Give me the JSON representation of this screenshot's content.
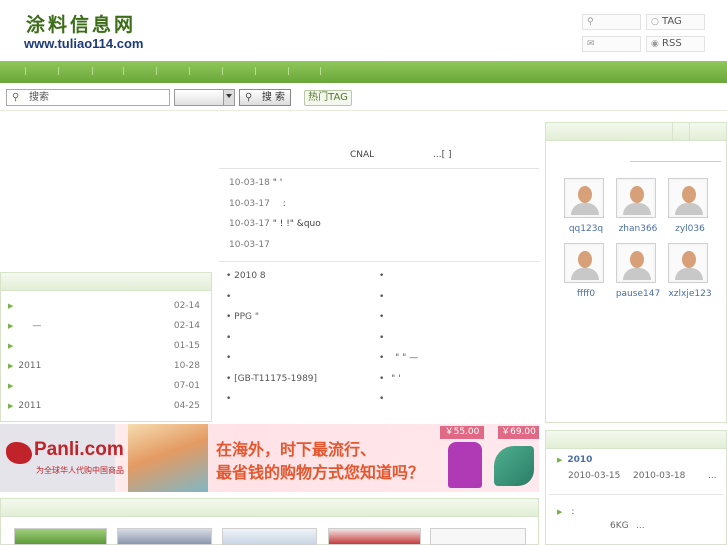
{
  "header": {
    "logo_cn": "涂料信息网",
    "logo_url": "www.tuliao114.com",
    "top_links": [
      {
        "icon": "user-icon",
        "label": ""
      },
      {
        "icon": "search-icon",
        "label": "TAG"
      },
      {
        "icon": "mail-icon",
        "label": ""
      },
      {
        "icon": "rss-icon",
        "label": "RSS"
      }
    ]
  },
  "search": {
    "placeholder": "搜索",
    "value": "搜索",
    "button_label": "搜 索",
    "hot_tag_label": "热门TAG"
  },
  "main": {
    "headline": "CNAL",
    "headline_more": "...[   ]",
    "news": [
      {
        "date": "10-03-18",
        "text": "\"   '"
      },
      {
        "date": "10-03-17",
        "text": ":"
      },
      {
        "date": "10-03-17",
        "text": "\" ! !\" &quo"
      },
      {
        "date": "10-03-17",
        "text": ""
      }
    ],
    "bullets_left": [
      "2010 8",
      "",
      "PPG      \"",
      "",
      "",
      "[GB-T11175-1989]",
      ""
    ],
    "bullets_right": [
      "",
      "",
      "",
      "",
      "\" \" —",
      "\"  '",
      ""
    ]
  },
  "left_list": [
    {
      "text": "",
      "date": "02-14"
    },
    {
      "text": "—",
      "date": "02-14"
    },
    {
      "text": "",
      "date": "01-15"
    },
    {
      "text": "2011",
      "date": "10-28"
    },
    {
      "text": "",
      "date": "07-01"
    },
    {
      "text": "2011",
      "date": "04-25"
    }
  ],
  "members": [
    {
      "name": "qq123q"
    },
    {
      "name": "zhan366"
    },
    {
      "name": "zyl036"
    },
    {
      "name": "ffff0"
    },
    {
      "name": "pause147"
    },
    {
      "name": "xzlxje123"
    }
  ],
  "right_bottom": {
    "item1_title": "2010",
    "item1_date1": "2010-03-15",
    "item1_date2": "2010-03-18",
    "item1_more": "...",
    "item2_title": ":",
    "item2_text": "6KG",
    "item2_more": "..."
  },
  "banner": {
    "brand": "Panli.com",
    "brand_sub": "为全球华人代购中国商品",
    "slogan_line1": "在海外，时下最流行、",
    "slogan_line2": "最省钱的购物方式您知道吗？",
    "price1": "￥55.00",
    "price2": "￥69.00"
  },
  "colors": {
    "nav_green": "#6aa63a",
    "logo_green": "#3c6e1a",
    "url_blue": "#1d3a78",
    "link_blue": "#4a6fa5",
    "banner_slogan": "#e4572e"
  }
}
